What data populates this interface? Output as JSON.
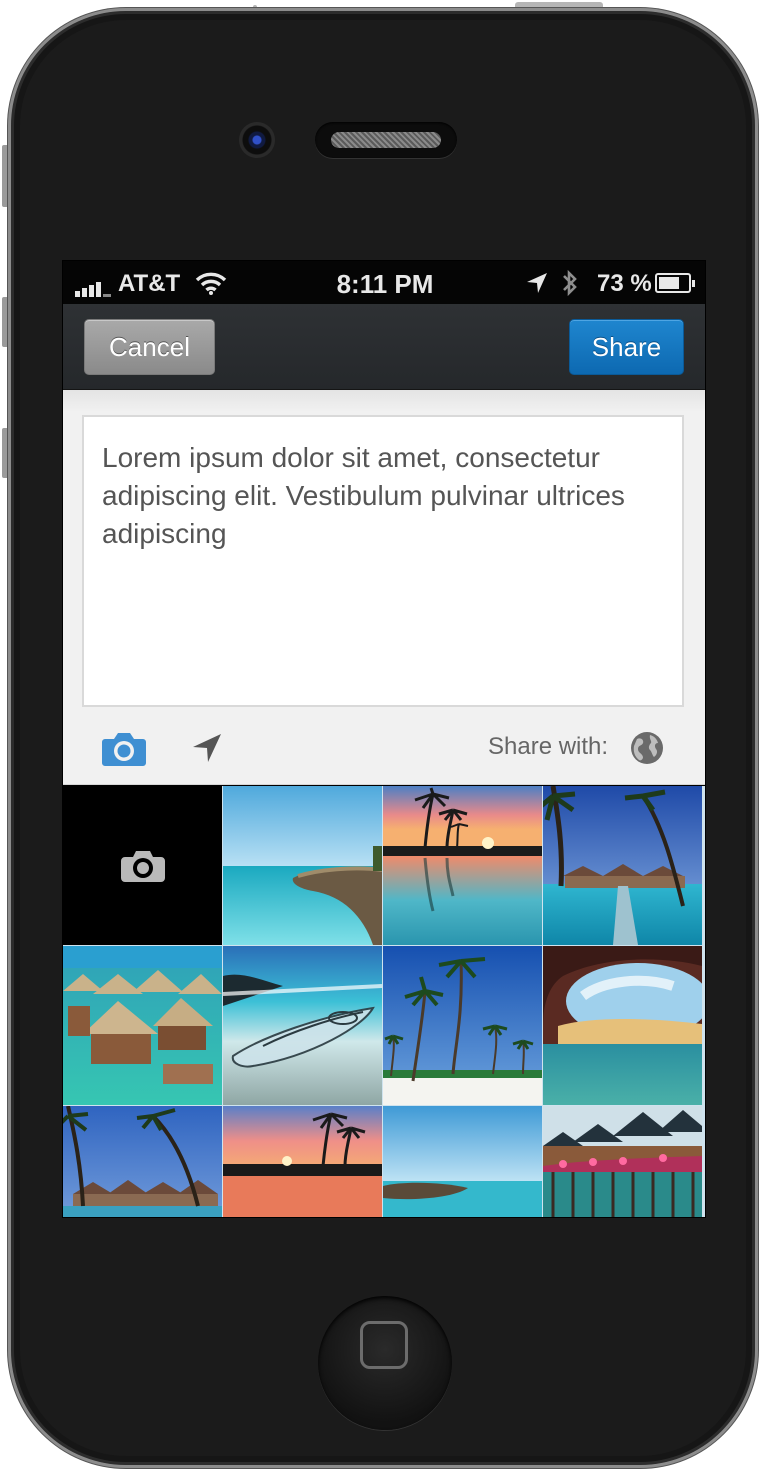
{
  "status_bar": {
    "carrier": "AT&T",
    "time": "8:11 PM",
    "battery_percent": "73 %",
    "battery_level": 0.73,
    "icons": [
      "signal-icon",
      "wifi-icon",
      "location-arrow-icon",
      "bluetooth-icon",
      "battery-icon"
    ]
  },
  "navbar": {
    "cancel_label": "Cancel",
    "share_label": "Share",
    "share_color": "#0f70ba",
    "cancel_color": "#999999"
  },
  "compose": {
    "text": "Lorem ipsum dolor sit amet, consectetur adipiscing elit. Vestibulum pulvinar ultrices adipiscing",
    "share_with_label": "Share with:",
    "toolbar_icons": [
      "camera-icon",
      "location-arrow-icon",
      "globe-icon"
    ],
    "accent": "#3f8fd2"
  },
  "photo_grid": {
    "first_tile_icon": "camera-icon",
    "photos": [
      "beach-rocks-turquoise",
      "sunset-palm-reflection",
      "palm-pier-overwater-bungalows",
      "overwater-bungalows-lagoon",
      "clear-kayak-beach",
      "palm-trees-blue-sky",
      "hidden-beach-cave",
      "palm-bungalows-dusk",
      "sunset-palms-water",
      "blue-sea-rock",
      "overwater-huts-flowers"
    ]
  }
}
